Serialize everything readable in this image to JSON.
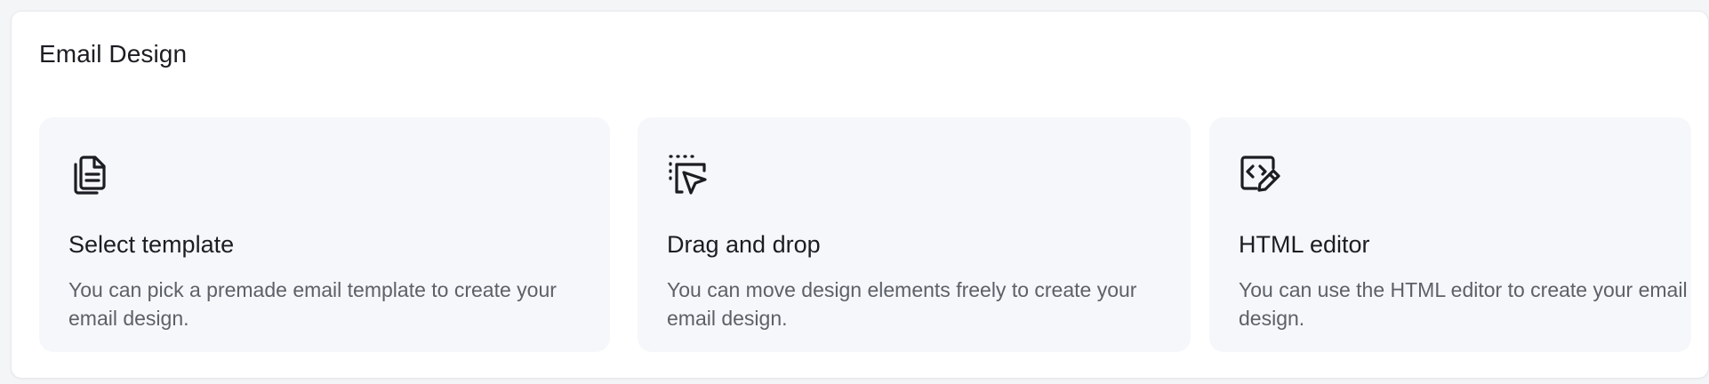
{
  "section": {
    "title": "Email Design"
  },
  "options": [
    {
      "title": "Select template",
      "description": "You can pick a premade email template to create your email design.",
      "icon": "document-icon"
    },
    {
      "title": "Drag and drop",
      "description": "You can move design elements freely to create your email design.",
      "icon": "cursor-select-icon"
    },
    {
      "title": "HTML editor",
      "description": "You can use the HTML editor to create your email design.",
      "icon": "code-edit-icon"
    }
  ],
  "colors": {
    "card_background": "#f6f7fa",
    "text_primary": "#1c1d22",
    "text_secondary": "#5d6068"
  }
}
